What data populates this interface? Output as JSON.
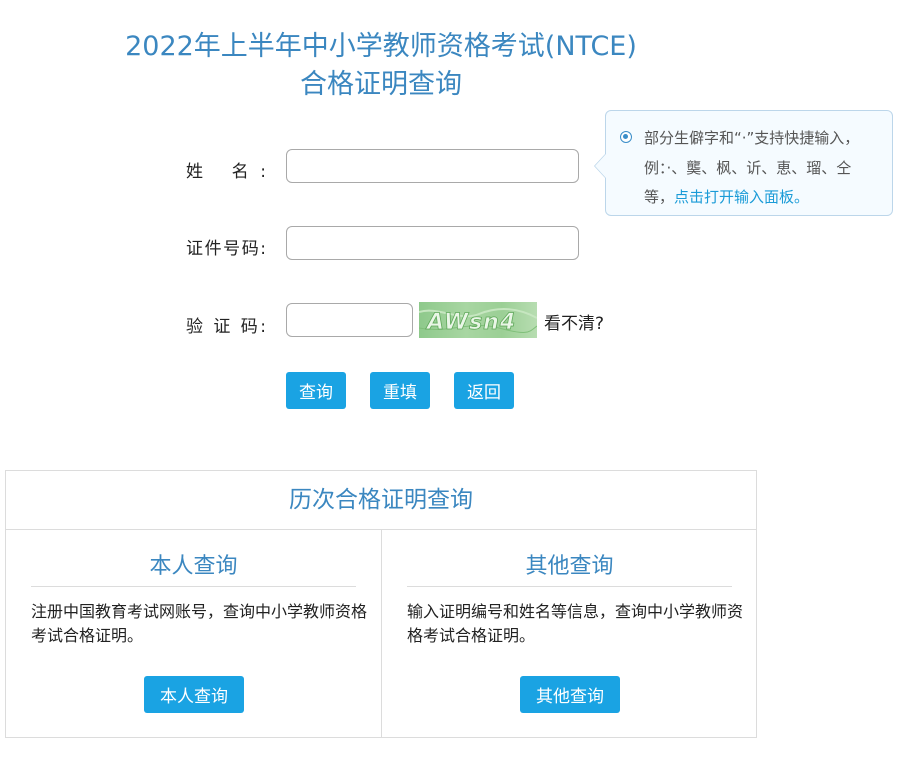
{
  "header": {
    "title_line1": "2022年上半年中小学教师资格考试(NTCE)",
    "title_line2": "合格证明查询"
  },
  "form": {
    "name_label": "姓    名:",
    "id_label": "证件号码:",
    "captcha_label": "验 证 码:",
    "name_value": "",
    "id_value": "",
    "captcha_value": "",
    "captcha_image_text": "AWsn4",
    "captcha_refresh": "看不清?"
  },
  "buttons": {
    "query": "查询",
    "reset": "重填",
    "back": "返回"
  },
  "tip": {
    "text": "部分生僻字和“·”支持快捷输入，例：·、龑、枫、䜣、恵、瑠、仝等，",
    "link": "点击打开输入面板。"
  },
  "history": {
    "title": "历次合格证明查询",
    "self": {
      "title": "本人查询",
      "desc": "注册中国教育考试网账号，查询中小学教师资格考试合格证明。",
      "button": "本人查询"
    },
    "other": {
      "title": "其他查询",
      "desc": "输入证明编号和姓名等信息，查询中小学教师资格考试合格证明。",
      "button": "其他查询"
    }
  },
  "colors": {
    "title_blue": "#3b87c0",
    "button_blue": "#1aa3e3",
    "link_blue": "#1a9bd7",
    "tip_bg": "#f5fbff",
    "tip_border": "#bcd6ea",
    "border_gray": "#dcdcdc"
  }
}
